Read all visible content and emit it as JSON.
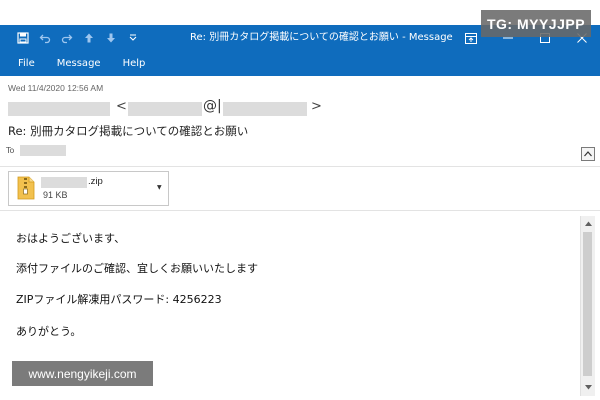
{
  "window": {
    "title": "Re: 別冊カタログ掲載についての確認とお願い  -  Message"
  },
  "quick_access": {
    "icons": [
      "save-icon",
      "undo-icon",
      "redo-icon",
      "up-arrow-icon",
      "down-arrow-icon",
      "customize-icon"
    ]
  },
  "menu": {
    "items": [
      {
        "label": "File"
      },
      {
        "label": "Message"
      },
      {
        "label": "Help"
      }
    ]
  },
  "header": {
    "date": "Wed 11/4/2020 12:56 AM",
    "from_lt": "<",
    "from_at": "@|",
    "from_gt": ">",
    "subject": "Re: 別冊カタログ掲載についての確認とお願い",
    "to_label": "To"
  },
  "attachment": {
    "name": ".zip",
    "size": "91 KB"
  },
  "body": {
    "lines": [
      "おはようございます、",
      "添付ファイルのご確認、宜しくお願いいたします",
      "ZIPファイル解凍用パスワード: 4256223",
      "ありがとう。"
    ]
  },
  "watermarks": {
    "top_right": "TG: MYYJJPP",
    "bottom_left": "www.nengyikeji.com"
  },
  "colors": {
    "titlebar": "#0f6cbd",
    "redaction": "#dcdcdc"
  }
}
